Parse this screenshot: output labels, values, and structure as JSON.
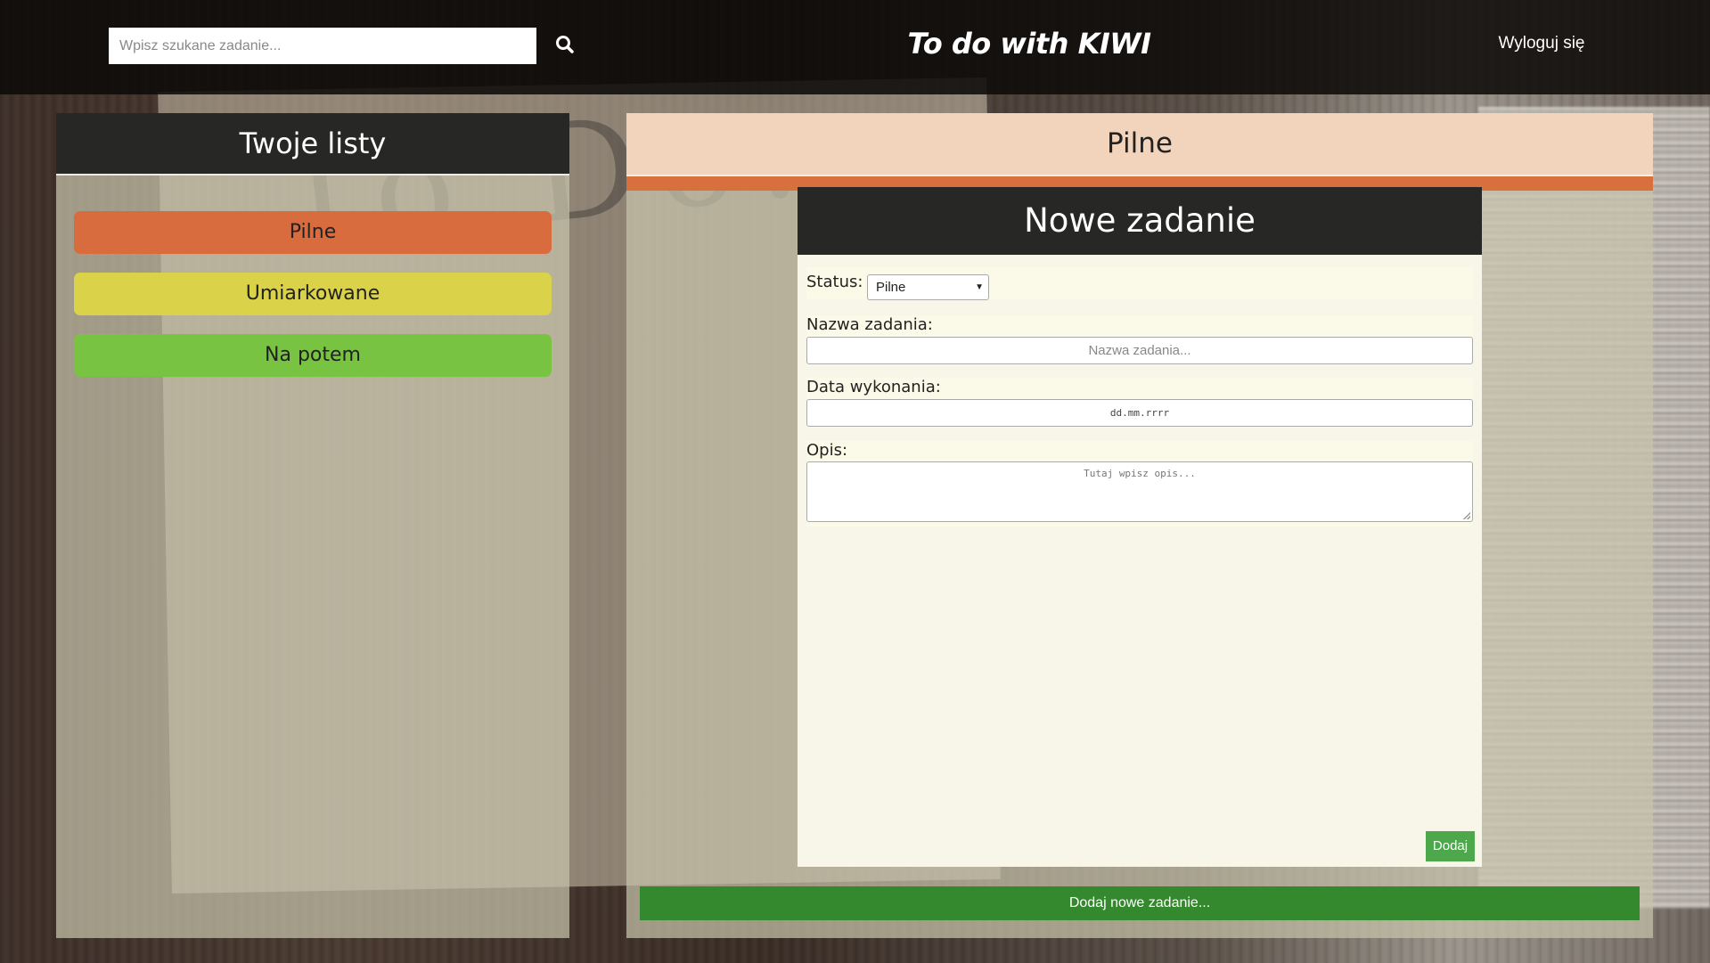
{
  "header": {
    "search_placeholder": "Wpisz szukane zadanie...",
    "search_icon": "search-icon",
    "app_title": "To do with KIWI",
    "logout_label": "Wyloguj się"
  },
  "sidebar": {
    "title": "Twoje listy",
    "lists": [
      {
        "label": "Pilne",
        "color": "#d96c3f"
      },
      {
        "label": "Umiarkowane",
        "color": "#dad34a"
      },
      {
        "label": "Na potem",
        "color": "#78c442"
      }
    ]
  },
  "main": {
    "list_title": "Pilne",
    "accent_color": "#d8703e",
    "form": {
      "title": "Nowe zadanie",
      "status_label": "Status:",
      "status_value": "Pilne",
      "name_label": "Nazwa zadania:",
      "name_placeholder": "Nazwa zadania...",
      "date_label": "Data wykonania:",
      "date_placeholder": "dd.mm.rrrr",
      "desc_label": "Opis:",
      "desc_placeholder": "Tutaj wpisz opis...",
      "submit_label": "Dodaj"
    },
    "add_task_label": "Dodaj nowe zadanie..."
  }
}
